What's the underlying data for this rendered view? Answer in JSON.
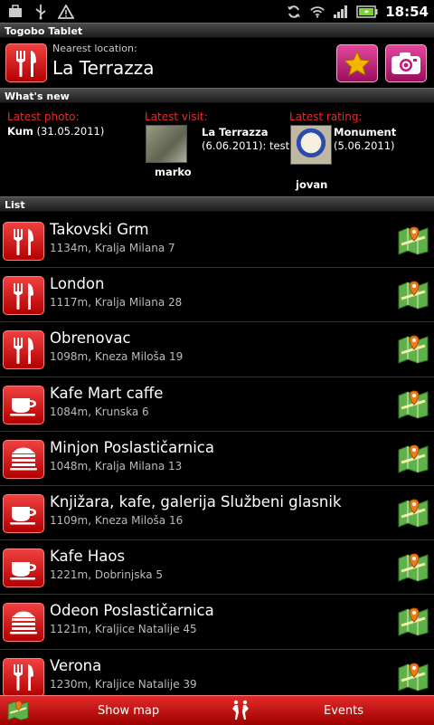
{
  "status_bar": {
    "time": "18:54",
    "battery_color": "#7bd13a"
  },
  "app_title": "Togobo Tablet",
  "nearest": {
    "label": "Nearest location:",
    "name": "La Terrazza",
    "icon": "restaurant-icon",
    "buttons": [
      {
        "icon": "star-icon"
      },
      {
        "icon": "camera-icon"
      }
    ]
  },
  "whats_new": {
    "header": "What's new",
    "latest_photo": {
      "title": "Latest photo:",
      "name": "Kum",
      "date": "(31.05.2011)"
    },
    "latest_visit": {
      "title": "Latest visit:",
      "name": "La Terrazza",
      "detail": "(6.06.2011): test",
      "user": "marko"
    },
    "latest_rating": {
      "title": "Latest rating:",
      "name": "Monument",
      "date": "(5.06.2011)",
      "user": "jovan"
    }
  },
  "list": {
    "header": "List",
    "items": [
      {
        "name": "Takovski Grm",
        "sub": "1134m, Kralja Milana 7",
        "icon": "restaurant-icon"
      },
      {
        "name": "London",
        "sub": "1117m, Kralja Milana 28",
        "icon": "restaurant-icon"
      },
      {
        "name": "Obrenovac",
        "sub": "1098m, Kneza Miloša 19",
        "icon": "restaurant-icon"
      },
      {
        "name": "Kafe Mart caffe",
        "sub": "1084m, Krunska 6",
        "icon": "coffee-cup-icon"
      },
      {
        "name": "Minjon Poslastičarnica",
        "sub": "1048m, Kralja Milana 13",
        "icon": "cake-icon"
      },
      {
        "name": "Knjižara, kafe, galerija Službeni glasnik",
        "sub": "1109m, Kneza Miloša 16",
        "icon": "coffee-cup-icon"
      },
      {
        "name": "Kafe Haos",
        "sub": "1221m, Dobrinjska 5",
        "icon": "coffee-cup-icon"
      },
      {
        "name": "Odeon Poslastičarnica",
        "sub": "1121m, Kraljice Natalije 45",
        "icon": "cake-icon"
      },
      {
        "name": "Verona",
        "sub": "1230m, Kraljice Natalije 39",
        "icon": "restaurant-icon"
      }
    ]
  },
  "bottom_bar": {
    "show_map": "Show map",
    "events": "Events"
  },
  "colors": {
    "accent_red": "#d40000",
    "accent_pink": "#c21a7a",
    "title_red": "#e82a2a"
  }
}
